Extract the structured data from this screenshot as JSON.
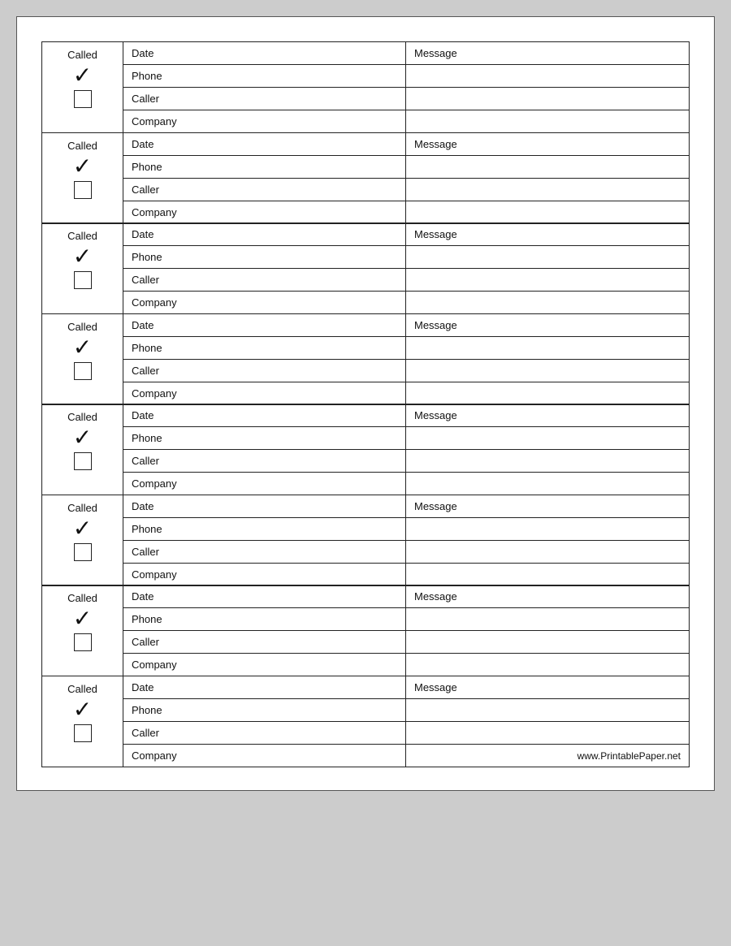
{
  "entries": [
    {
      "id": 1,
      "called_label": "Called",
      "checkmark": "✓",
      "date": "Date",
      "phone": "Phone",
      "caller": "Caller",
      "company": "Company",
      "message": "Message",
      "is_last": false
    },
    {
      "id": 2,
      "called_label": "Called",
      "checkmark": "✓",
      "date": "Date",
      "phone": "Phone",
      "caller": "Caller",
      "company": "Company",
      "message": "Message",
      "is_last": false
    },
    {
      "id": 3,
      "called_label": "Called",
      "checkmark": "✓",
      "date": "Date",
      "phone": "Phone",
      "caller": "Caller",
      "company": "Company",
      "message": "Message",
      "is_last": false
    },
    {
      "id": 4,
      "called_label": "Called",
      "checkmark": "✓",
      "date": "Date",
      "phone": "Phone",
      "caller": "Caller",
      "company": "Company",
      "message": "Message",
      "is_last": false
    },
    {
      "id": 5,
      "called_label": "Called",
      "checkmark": "✓",
      "date": "Date",
      "phone": "Phone",
      "caller": "Caller",
      "company": "Company",
      "message": "Message",
      "is_last": false
    },
    {
      "id": 6,
      "called_label": "Called",
      "checkmark": "✓",
      "date": "Date",
      "phone": "Phone",
      "caller": "Caller",
      "company": "Company",
      "message": "Message",
      "is_last": false
    },
    {
      "id": 7,
      "called_label": "Called",
      "checkmark": "✓",
      "date": "Date",
      "phone": "Phone",
      "caller": "Caller",
      "company": "Company",
      "message": "Message",
      "is_last": false
    },
    {
      "id": 8,
      "called_label": "Called",
      "checkmark": "✓",
      "date": "Date",
      "phone": "Phone",
      "caller": "Caller",
      "company": "Company",
      "message": "Message",
      "is_last": true
    }
  ],
  "website": "www.PrintablePaper.net"
}
